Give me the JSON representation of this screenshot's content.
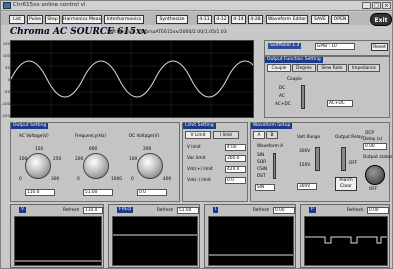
{
  "window": {
    "title": "Chr615xx online control vi",
    "min": "_",
    "max": "□",
    "close": "×"
  },
  "toolbar": {
    "buttons": [
      "List",
      "Pulse",
      "Step",
      "Harmonics Meas",
      "Interharmonics",
      "Synthesize",
      "4-11",
      "4-12",
      "4-14",
      "4-28",
      "Waveform Editor",
      "SAVE",
      "OPEN"
    ],
    "exit": "Exit"
  },
  "header": {
    "title": "Chroma AC SOURCE 615xx",
    "version": "Soft Version: ChromaATE615xx/2000/2.00/1.05/1.03"
  },
  "scope": {
    "ylabels": [
      "150",
      "100",
      "50",
      "0",
      "-50",
      "-100",
      "-150"
    ]
  },
  "selfpanel": {
    "label": "SelfPanel 1.3",
    "gpib_label": "GPIB : 10",
    "reset": "Reset"
  },
  "output_function": {
    "title": "Output Function Setting",
    "tabs": [
      "Couple",
      "Degree",
      "Slew Rate",
      "Impedance"
    ],
    "couple_label": "Couple",
    "options": [
      "DC",
      "AC",
      "AC+DC"
    ],
    "value": "AC+DC"
  },
  "output_setting": {
    "title": "Output Setting",
    "ac": {
      "label": "AC Voltage(V)",
      "ticks": [
        "0",
        "100",
        "150",
        "200",
        "250",
        "300"
      ],
      "value": "110.0"
    },
    "freq": {
      "label": "Frequency(Hz)",
      "ticks": [
        "0",
        "200",
        "400",
        "600",
        "800",
        "1000"
      ],
      "value": "51.00"
    },
    "dc": {
      "label": "DC Voltage(V)",
      "ticks": [
        "0",
        "100",
        "200",
        "300",
        "400"
      ],
      "value": "0.0"
    }
  },
  "limit": {
    "title": "Limit Setting",
    "tabs": [
      "V Limit",
      "I limit"
    ],
    "rows": [
      {
        "label": "V limit",
        "value": "4.00"
      },
      {
        "label": "Vac limit",
        "value": "300.0"
      },
      {
        "label": "Vdc(+) limit",
        "value": "424.0"
      },
      {
        "label": "Vdc(-) limit",
        "value": "0.0"
      }
    ]
  },
  "waveform": {
    "title": "Waveform Setup",
    "tabs": [
      "A",
      "B"
    ],
    "wave_label": "Waveform A",
    "options": [
      "SIN",
      "SQR",
      "CSIN",
      "DST"
    ],
    "value": "SIN",
    "volt_range": "Volt Range",
    "output_relay": "Output Relay",
    "ocp": "OCP",
    "ocp_delay": "Delay (s)",
    "ocp_value": "0.00",
    "range_hi": "300V",
    "range_lo": "150V",
    "relay_state": "OFF",
    "range_box": "300V",
    "alarm": "Alarm Clear",
    "output_status": "Output status",
    "status_off": "OFF"
  },
  "monitors": [
    {
      "label": "V",
      "refresh": "Refresh",
      "value": "110.0"
    },
    {
      "label": "FREQ",
      "refresh": "Refresh",
      "value": "51.00"
    },
    {
      "label": "I",
      "refresh": "Refresh",
      "value": "0.00"
    },
    {
      "label": "P",
      "refresh": "Refresh",
      "value": "0.00"
    }
  ]
}
